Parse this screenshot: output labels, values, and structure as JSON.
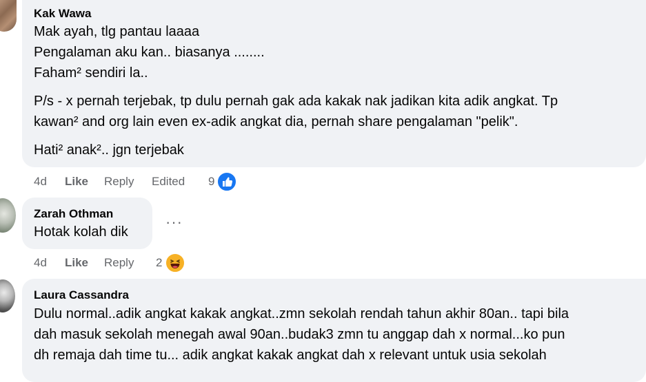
{
  "comments": [
    {
      "author": "Kak Wawa",
      "lines": [
        "Mak ayah, tlg pantau laaaa",
        "Pengalaman aku kan.. biasanya ........",
        "Faham² sendiri la..",
        "P/s - x pernah terjebak, tp dulu pernah gak ada kakak nak jadikan kita adik angkat. Tp",
        "kawan² and org lain even ex-adik angkat dia, pernah share pengalaman \"pelik\".",
        "Hati² anak².. jgn terjebak"
      ],
      "time": "4d",
      "like_label": "Like",
      "reply_label": "Reply",
      "edited_label": "Edited",
      "reaction_count": "9",
      "reaction_icon": "like-reaction-icon"
    },
    {
      "author": "Zarah Othman",
      "lines": [
        "Hotak kolah dik"
      ],
      "time": "4d",
      "like_label": "Like",
      "reply_label": "Reply",
      "reaction_count": "2",
      "reaction_icon": "haha-reaction-icon",
      "more_label": "···"
    },
    {
      "author": "Laura Cassandra",
      "lines": [
        "Dulu normal..adik angkat kakak angkat..zmn sekolah rendah tahun akhir 80an.. tapi bila",
        "dah masuk sekolah menegah awal 90an..budak3 zmn tu anggap dah x normal...ko pun",
        "dh remaja dah time tu... adik angkat kakak angkat dah x relevant untuk usia sekolah"
      ]
    }
  ],
  "colors": {
    "bubble": "#f0f2f5",
    "meta_text": "#65676b",
    "like_blue": "#1877f2",
    "haha_yellow": "#f7b125"
  }
}
